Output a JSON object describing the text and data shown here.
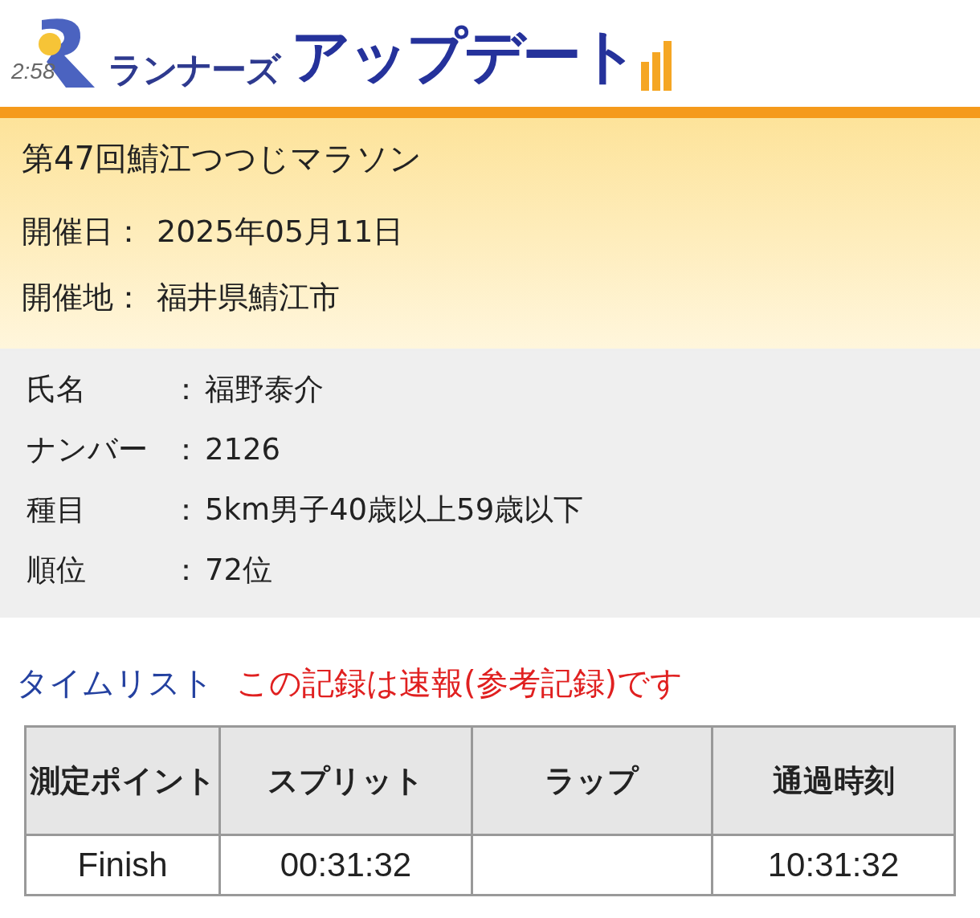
{
  "logo": {
    "badge": "2:58",
    "name_small": "ランナーズ",
    "name_large": "アップデート"
  },
  "event": {
    "title": "第47回鯖江つつじマラソン",
    "fields": [
      {
        "label": "開催日：",
        "value": "2025年05月11日"
      },
      {
        "label": "開催地：",
        "value": "福井県鯖江市"
      }
    ]
  },
  "runner": [
    {
      "label": "氏名",
      "sep": "：",
      "value": "福野泰介"
    },
    {
      "label": "ナンバー",
      "sep": "：",
      "value": "2126"
    },
    {
      "label": "種目",
      "sep": "：",
      "value": "5km男子40歳以上59歳以下"
    },
    {
      "label": "順位",
      "sep": "：",
      "value": "72位"
    }
  ],
  "time_list": {
    "heading": "タイムリスト",
    "notice": "この記録は速報(参考記録)です",
    "columns": [
      "測定ポイント",
      "スプリット",
      "ラップ",
      "通過時刻"
    ],
    "rows": [
      [
        "Finish",
        "00:31:32",
        "",
        "10:31:32"
      ]
    ]
  }
}
